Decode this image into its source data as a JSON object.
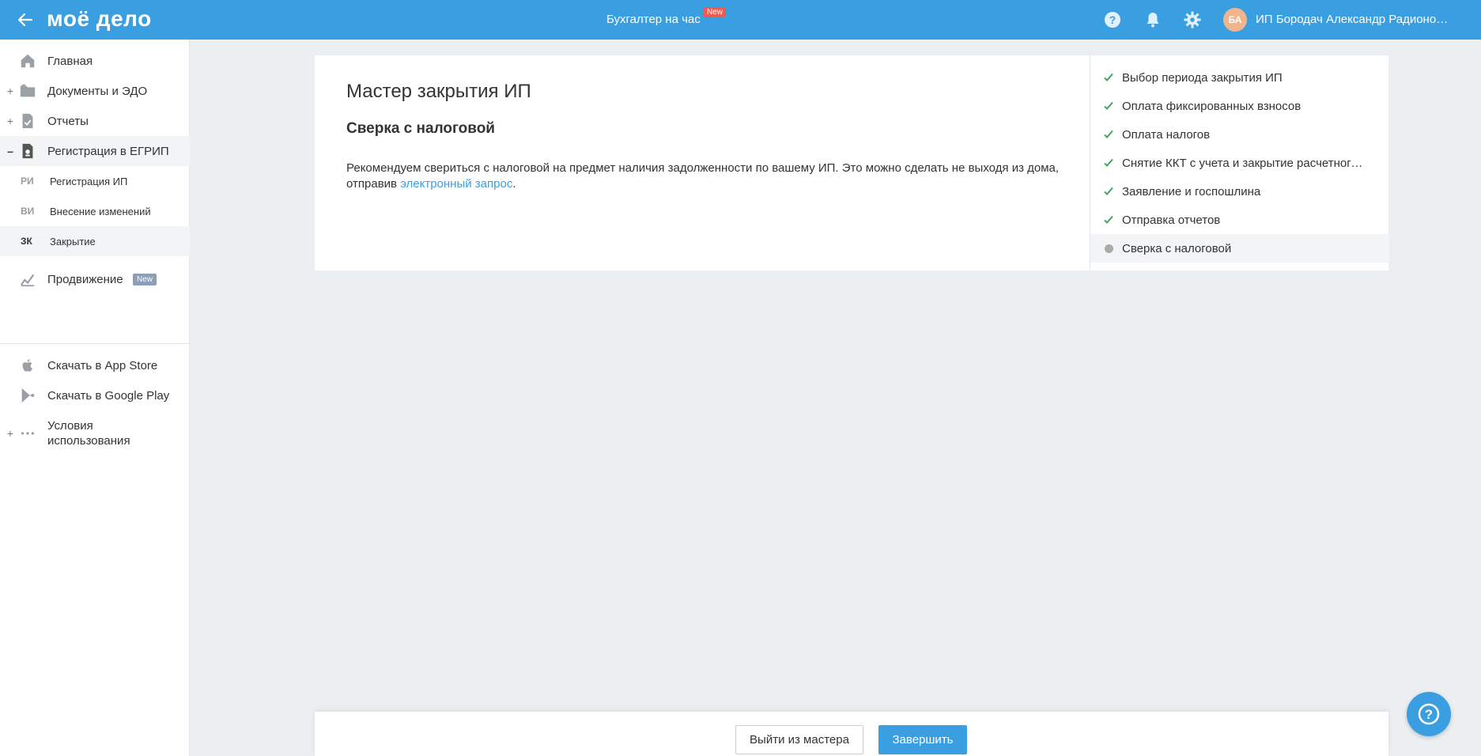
{
  "header": {
    "logo": "моё дело",
    "center_link": "Бухгалтер на час",
    "center_badge": "New",
    "avatar_initials": "БА",
    "user_name": "ИП Бородач Александр Радионович"
  },
  "sidebar": {
    "items": [
      {
        "label": "Главная",
        "icon": "home-icon"
      },
      {
        "label": "Документы и ЭДО",
        "icon": "folder-icon",
        "expander": "+"
      },
      {
        "label": "Отчеты",
        "icon": "report-icon",
        "expander": "+"
      },
      {
        "label": "Регистрация в ЕГРИП",
        "icon": "registration-icon",
        "expander": "–"
      },
      {
        "label": "Продвижение",
        "icon": "chart-icon",
        "badge": "New"
      },
      {
        "label": "Скачать в App Store",
        "icon": "apple-icon"
      },
      {
        "label": "Скачать в Google Play",
        "icon": "google-play-icon"
      },
      {
        "label": "Условия использования",
        "icon": "more-icon",
        "expander": "+"
      }
    ],
    "subitems": [
      {
        "abbr": "РИ",
        "label": "Регистрация ИП"
      },
      {
        "abbr": "ВИ",
        "label": "Внесение изменений"
      },
      {
        "abbr": "ЗК",
        "label": "Закрытие"
      }
    ]
  },
  "main": {
    "title": "Мастер закрытия ИП",
    "subtitle": "Сверка с налоговой",
    "text_before": "Рекомендуем свериться с налоговой на предмет наличия задолженности по вашему ИП. Это можно сделать не выходя из дома, отправив ",
    "link": "электронный запрос",
    "text_after": "."
  },
  "steps": [
    {
      "label": "Выбор периода закрытия ИП",
      "status": "done"
    },
    {
      "label": "Оплата фиксированных взносов",
      "status": "done"
    },
    {
      "label": "Оплата налогов",
      "status": "done"
    },
    {
      "label": "Снятие ККТ с учета и закрытие расчетного счета",
      "status": "done"
    },
    {
      "label": "Заявление и госпошлина",
      "status": "done"
    },
    {
      "label": "Отправка отчетов",
      "status": "done"
    },
    {
      "label": "Сверка с налоговой",
      "status": "current"
    }
  ],
  "footer": {
    "exit_label": "Выйти из мастера",
    "finish_label": "Завершить"
  },
  "colors": {
    "header_bg": "#3a9fe0",
    "accent": "#3a9fe0",
    "check": "#3aaa5a",
    "badge_red": "#f05a4f",
    "badge_gray": "#8a9fb8"
  }
}
